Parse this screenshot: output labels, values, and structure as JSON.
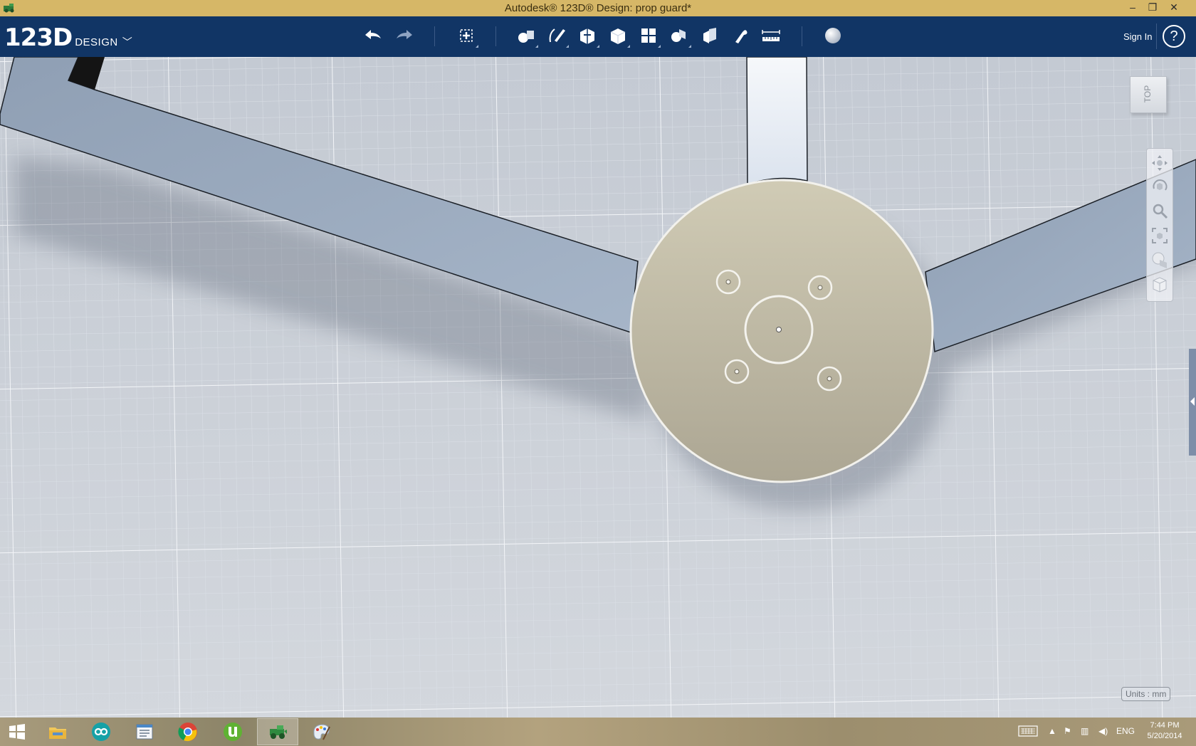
{
  "window": {
    "title": "Autodesk® 123D® Design: prop guard*",
    "minimize_glyph": "–",
    "restore_glyph": "❐",
    "close_glyph": "✕"
  },
  "app": {
    "logo_number": "123D",
    "logo_word": "DESIGN",
    "logo_chevron": "﹀"
  },
  "toolbar": {
    "tools": [
      {
        "name": "undo-icon"
      },
      {
        "name": "redo-icon"
      },
      {
        "name": "transform-icon"
      },
      {
        "name": "primitives-icon"
      },
      {
        "name": "sketch-icon"
      },
      {
        "name": "construct-icon"
      },
      {
        "name": "modify-icon"
      },
      {
        "name": "pattern-icon"
      },
      {
        "name": "grouping-icon"
      },
      {
        "name": "combine-icon"
      },
      {
        "name": "snap-icon"
      },
      {
        "name": "measure-icon"
      },
      {
        "name": "material-icon"
      }
    ],
    "sign_in_label": "Sign In",
    "help_label": "?"
  },
  "viewport": {
    "viewcube_label": "TOP",
    "nav_tools": [
      "pan-icon",
      "orbit-icon",
      "zoom-icon",
      "fit-icon",
      "visibility-icon",
      "view-mode-icon"
    ],
    "units_label": "Units : mm"
  },
  "taskbar": {
    "apps": [
      "windows-start-icon",
      "file-explorer-icon",
      "arduino-icon",
      "notepad-icon",
      "chrome-icon",
      "utorrent-icon",
      "123d-design-icon",
      "paint-icon"
    ],
    "tray": {
      "language": "ENG",
      "time": "7:44 PM",
      "date": "5/20/2014"
    }
  },
  "colors": {
    "title_bar": "#d6b767",
    "toolbar": "#113565",
    "grid_background": "#c9ced6",
    "arm": "#9aaabd",
    "hub": "#c2bca6"
  }
}
